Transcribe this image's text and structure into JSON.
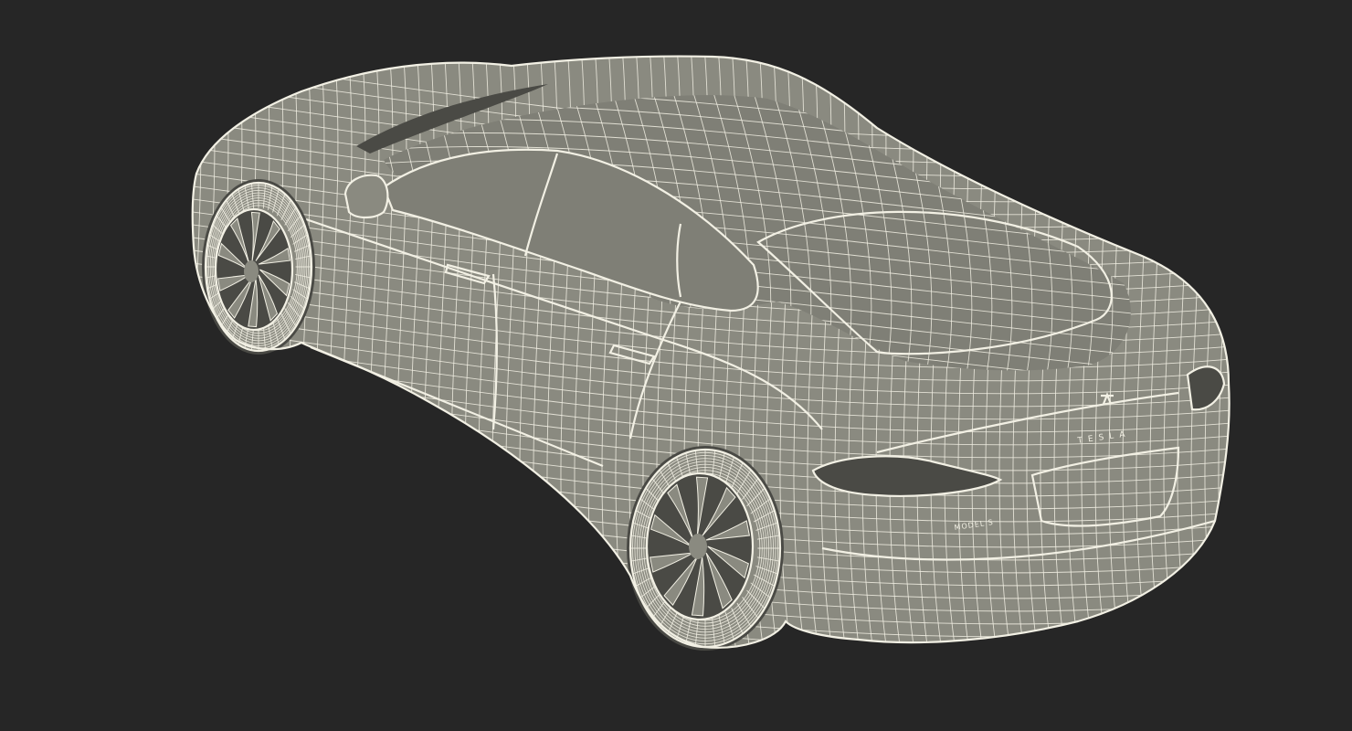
{
  "scene": {
    "background_color": "#262626",
    "wire_color": "#f2f0e4",
    "surface_color": "#8a8a80"
  },
  "car": {
    "badge_brand": "TESLA",
    "badge_model": "MODEL S"
  }
}
